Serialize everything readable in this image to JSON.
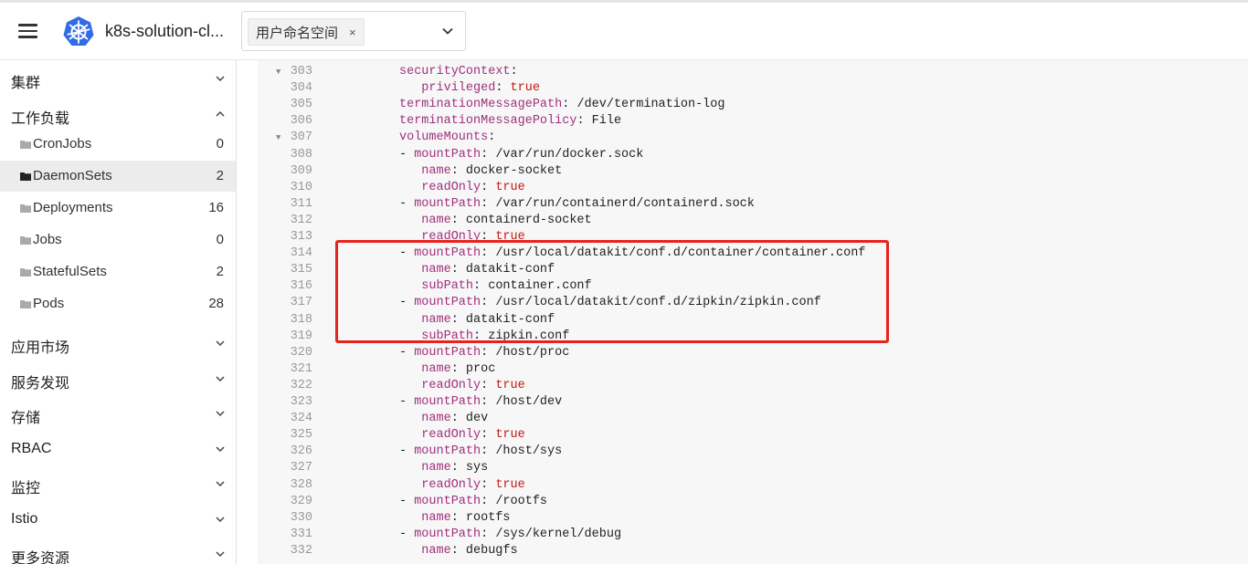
{
  "app": {
    "title": "k8s-solution-cl...",
    "namespace_chip": "用户命名空间",
    "chip_remove": "×"
  },
  "icons": {
    "menu": "hamburger-icon",
    "logo": "kubernetes-logo",
    "close": "close-icon",
    "dropdown": "chevron-down-icon",
    "folder": "folder-icon"
  },
  "colors": {
    "accent": "#326ce5",
    "highlight": "#e8221c",
    "yaml_key": "#a0307c",
    "yaml_bool": "#c41a16"
  },
  "sidebar": {
    "sections": [
      {
        "label": "集群",
        "expanded": false
      },
      {
        "label": "工作负载",
        "expanded": true
      },
      {
        "label": "应用市场",
        "expanded": false
      },
      {
        "label": "服务发现",
        "expanded": false
      },
      {
        "label": "存储",
        "expanded": false
      },
      {
        "label": "RBAC",
        "expanded": false
      },
      {
        "label": "监控",
        "expanded": false
      },
      {
        "label": "Istio",
        "expanded": false
      },
      {
        "label": "更多资源",
        "expanded": false
      }
    ],
    "workloads": [
      {
        "label": "CronJobs",
        "count": "0",
        "active": false
      },
      {
        "label": "DaemonSets",
        "count": "2",
        "active": true
      },
      {
        "label": "Deployments",
        "count": "16",
        "active": false
      },
      {
        "label": "Jobs",
        "count": "0",
        "active": false
      },
      {
        "label": "StatefulSets",
        "count": "2",
        "active": false
      },
      {
        "label": "Pods",
        "count": "28",
        "active": false
      }
    ]
  },
  "editor": {
    "lines": [
      {
        "n": "303",
        "fold": true,
        "indent": 0,
        "dash": false,
        "key": "securityContext",
        "sep": ":",
        "val": "",
        "vtype": ""
      },
      {
        "n": "304",
        "fold": false,
        "indent": 1,
        "dash": false,
        "key": "privileged",
        "sep": ": ",
        "val": "true",
        "vtype": "bool"
      },
      {
        "n": "305",
        "fold": false,
        "indent": 0,
        "dash": false,
        "key": "terminationMessagePath",
        "sep": ": ",
        "val": "/dev/termination-log",
        "vtype": "str"
      },
      {
        "n": "306",
        "fold": false,
        "indent": 0,
        "dash": false,
        "key": "terminationMessagePolicy",
        "sep": ": ",
        "val": "File",
        "vtype": "str"
      },
      {
        "n": "307",
        "fold": true,
        "indent": 0,
        "dash": false,
        "key": "volumeMounts",
        "sep": ":",
        "val": "",
        "vtype": ""
      },
      {
        "n": "308",
        "fold": false,
        "indent": 0,
        "dash": true,
        "key": "mountPath",
        "sep": ": ",
        "val": "/var/run/docker.sock",
        "vtype": "str"
      },
      {
        "n": "309",
        "fold": false,
        "indent": 1,
        "dash": false,
        "key": "name",
        "sep": ": ",
        "val": "docker-socket",
        "vtype": "str"
      },
      {
        "n": "310",
        "fold": false,
        "indent": 1,
        "dash": false,
        "key": "readOnly",
        "sep": ": ",
        "val": "true",
        "vtype": "bool"
      },
      {
        "n": "311",
        "fold": false,
        "indent": 0,
        "dash": true,
        "key": "mountPath",
        "sep": ": ",
        "val": "/var/run/containerd/containerd.sock",
        "vtype": "str"
      },
      {
        "n": "312",
        "fold": false,
        "indent": 1,
        "dash": false,
        "key": "name",
        "sep": ": ",
        "val": "containerd-socket",
        "vtype": "str"
      },
      {
        "n": "313",
        "fold": false,
        "indent": 1,
        "dash": false,
        "key": "readOnly",
        "sep": ": ",
        "val": "true",
        "vtype": "bool"
      },
      {
        "n": "314",
        "fold": false,
        "indent": 0,
        "dash": true,
        "key": "mountPath",
        "sep": ": ",
        "val": "/usr/local/datakit/conf.d/container/container.conf",
        "vtype": "str"
      },
      {
        "n": "315",
        "fold": false,
        "indent": 1,
        "dash": false,
        "key": "name",
        "sep": ": ",
        "val": "datakit-conf",
        "vtype": "str"
      },
      {
        "n": "316",
        "fold": false,
        "indent": 1,
        "dash": false,
        "key": "subPath",
        "sep": ": ",
        "val": "container.conf",
        "vtype": "str"
      },
      {
        "n": "317",
        "fold": false,
        "indent": 0,
        "dash": true,
        "key": "mountPath",
        "sep": ": ",
        "val": "/usr/local/datakit/conf.d/zipkin/zipkin.conf",
        "vtype": "str"
      },
      {
        "n": "318",
        "fold": false,
        "indent": 1,
        "dash": false,
        "key": "name",
        "sep": ": ",
        "val": "datakit-conf",
        "vtype": "str"
      },
      {
        "n": "319",
        "fold": false,
        "indent": 1,
        "dash": false,
        "key": "subPath",
        "sep": ": ",
        "val": "zipkin.conf",
        "vtype": "str"
      },
      {
        "n": "320",
        "fold": false,
        "indent": 0,
        "dash": true,
        "key": "mountPath",
        "sep": ": ",
        "val": "/host/proc",
        "vtype": "str"
      },
      {
        "n": "321",
        "fold": false,
        "indent": 1,
        "dash": false,
        "key": "name",
        "sep": ": ",
        "val": "proc",
        "vtype": "str"
      },
      {
        "n": "322",
        "fold": false,
        "indent": 1,
        "dash": false,
        "key": "readOnly",
        "sep": ": ",
        "val": "true",
        "vtype": "bool"
      },
      {
        "n": "323",
        "fold": false,
        "indent": 0,
        "dash": true,
        "key": "mountPath",
        "sep": ": ",
        "val": "/host/dev",
        "vtype": "str"
      },
      {
        "n": "324",
        "fold": false,
        "indent": 1,
        "dash": false,
        "key": "name",
        "sep": ": ",
        "val": "dev",
        "vtype": "str"
      },
      {
        "n": "325",
        "fold": false,
        "indent": 1,
        "dash": false,
        "key": "readOnly",
        "sep": ": ",
        "val": "true",
        "vtype": "bool"
      },
      {
        "n": "326",
        "fold": false,
        "indent": 0,
        "dash": true,
        "key": "mountPath",
        "sep": ": ",
        "val": "/host/sys",
        "vtype": "str"
      },
      {
        "n": "327",
        "fold": false,
        "indent": 1,
        "dash": false,
        "key": "name",
        "sep": ": ",
        "val": "sys",
        "vtype": "str"
      },
      {
        "n": "328",
        "fold": false,
        "indent": 1,
        "dash": false,
        "key": "readOnly",
        "sep": ": ",
        "val": "true",
        "vtype": "bool"
      },
      {
        "n": "329",
        "fold": false,
        "indent": 0,
        "dash": true,
        "key": "mountPath",
        "sep": ": ",
        "val": "/rootfs",
        "vtype": "str"
      },
      {
        "n": "330",
        "fold": false,
        "indent": 1,
        "dash": false,
        "key": "name",
        "sep": ": ",
        "val": "rootfs",
        "vtype": "str"
      },
      {
        "n": "331",
        "fold": false,
        "indent": 0,
        "dash": true,
        "key": "mountPath",
        "sep": ": ",
        "val": "/sys/kernel/debug",
        "vtype": "str"
      },
      {
        "n": "332",
        "fold": false,
        "indent": 1,
        "dash": false,
        "key": "name",
        "sep": ": ",
        "val": "debugfs",
        "vtype": "str"
      }
    ]
  }
}
